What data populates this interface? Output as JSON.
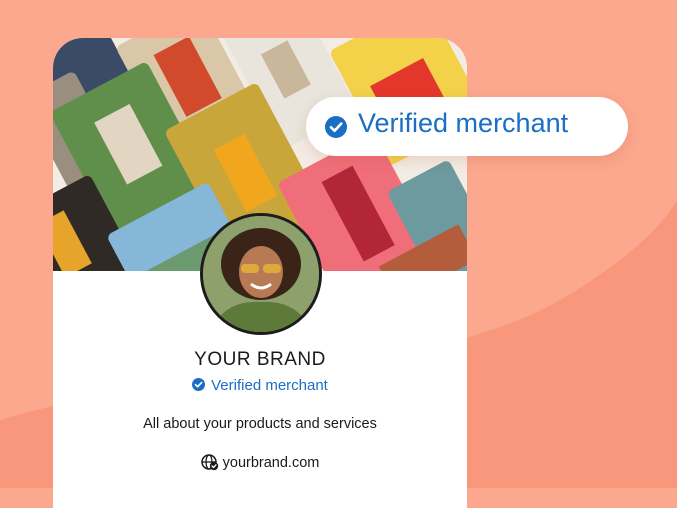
{
  "badge": {
    "label": "Verified merchant",
    "icon": "check-circle-icon"
  },
  "profile": {
    "brand_name": "YOUR BRAND",
    "verified_label": "Verified merchant",
    "description": "All about your products and services",
    "website": "yourbrand.com",
    "website_icon": "globe-icon"
  },
  "colors": {
    "background": "#FBA88E",
    "accent": "#1A6FC4",
    "card": "#FFFFFF"
  }
}
